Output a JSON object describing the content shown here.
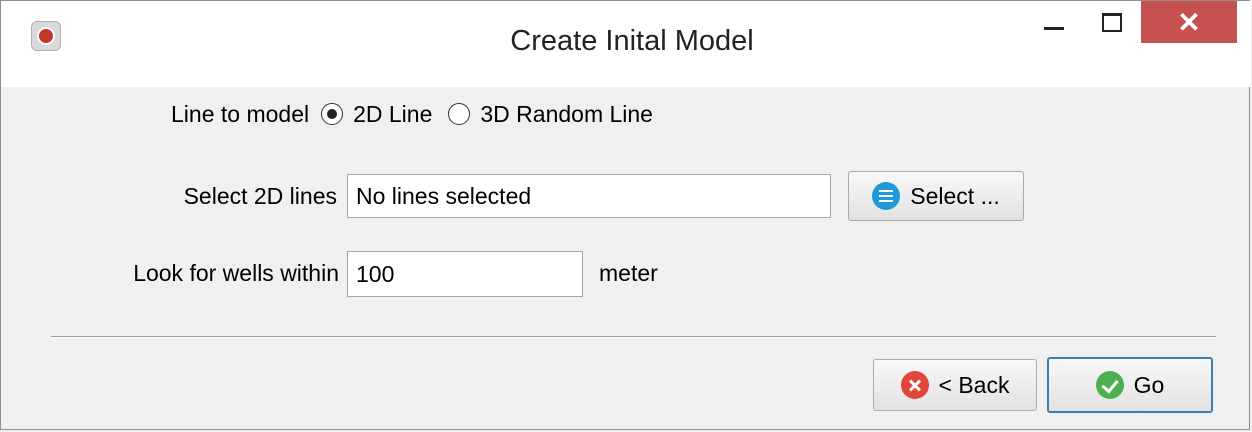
{
  "window": {
    "title": "Create Inital Model",
    "close_glyph": "✕"
  },
  "form": {
    "line_to_model": {
      "label": "Line to model",
      "options": [
        {
          "label": "2D Line",
          "selected": true
        },
        {
          "label": "3D Random Line",
          "selected": false
        }
      ]
    },
    "select_lines": {
      "label": "Select 2D lines",
      "value": "No lines selected",
      "button_label": "Select ..."
    },
    "wells": {
      "label": "Look for wells within",
      "value": "100",
      "unit": "meter"
    }
  },
  "footer": {
    "back_label": "< Back",
    "go_label": "Go"
  },
  "icons": {
    "select": "list-icon",
    "back": "cancel-icon",
    "go": "check-icon"
  },
  "colors": {
    "close_button": "#c75050",
    "select_icon": "#1e9ad6",
    "back_icon": "#e0463c",
    "go_icon": "#4caf50",
    "primary_border": "#3c7fb1"
  }
}
